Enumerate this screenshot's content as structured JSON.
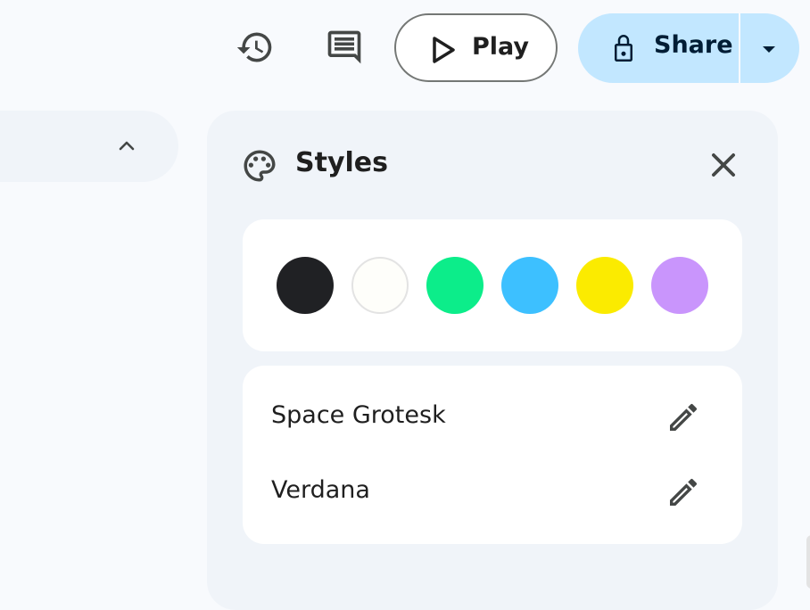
{
  "toolbar": {
    "history_icon": "history-icon",
    "comments_icon": "comments-icon",
    "play_label": "Play",
    "share_label": "Share"
  },
  "styles_panel": {
    "title": "Styles",
    "palette_icon": "palette-icon",
    "close_icon": "close-icon",
    "colors": [
      "#202124",
      "#fefefa",
      "#0ced8a",
      "#3dc0ff",
      "#fbeb00",
      "#c995fc"
    ],
    "fonts": [
      {
        "name": "Space Grotesk",
        "edit_icon": "pencil-icon"
      },
      {
        "name": "Verdana",
        "edit_icon": "pencil-icon"
      }
    ]
  },
  "accent": {
    "share_bg": "#c2e7ff",
    "panel_bg": "#f0f4f9",
    "page_bg": "#f8fafd"
  }
}
